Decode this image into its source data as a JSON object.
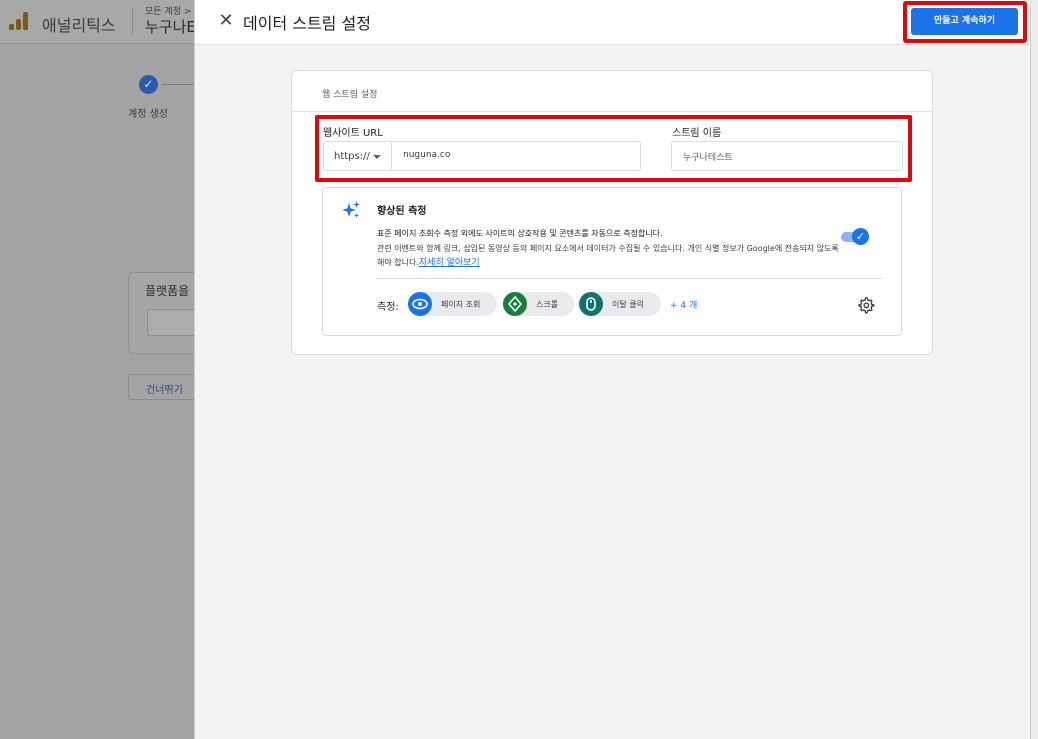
{
  "background": {
    "app_name": "애널리틱스",
    "breadcrumb_small": "모든 계정 >",
    "breadcrumb_big": "누구나E",
    "step_label": "계정 생성",
    "card_title": "플랫폼을",
    "skip_label": "건너뛰기"
  },
  "modal": {
    "title": "데이터 스트림 설정",
    "primary_button": "만들고 계속하기",
    "panel_title": "웹 스트림 설정",
    "url_label": "웹사이트 URL",
    "protocol": "https://",
    "url_value": "nuguna.co",
    "name_label": "스트림 이름",
    "name_value": "누구나테스트",
    "enhanced": {
      "title": "향상된 측정",
      "desc1": "표준 페이지 조회수 측정 외에도 사이트의 상호작용 및 콘텐츠를 자동으로 측정합니다.",
      "desc2": "관련 이벤트와 함께 링크, 삽입된 동영상 등의 페이지 요소에서 데이터가 수집될 수 있습니다. 개인 식별 정보가 Google에 전송되지 않도록 해야 합니다.",
      "learn_more": "자세히 알아보기",
      "toggle_on": true,
      "measure_label": "측정:",
      "chips": [
        {
          "label": "페이지 조회",
          "icon": "eye-icon",
          "color": "#1a73e8"
        },
        {
          "label": "스크롤",
          "icon": "scroll-icon",
          "color": "#188038"
        },
        {
          "label": "이탈 클릭",
          "icon": "mouse-icon",
          "color": "#137170"
        }
      ],
      "more": "+ 4 개"
    }
  },
  "colors": {
    "accent": "#1a73e8",
    "highlight": "#e0060b"
  }
}
